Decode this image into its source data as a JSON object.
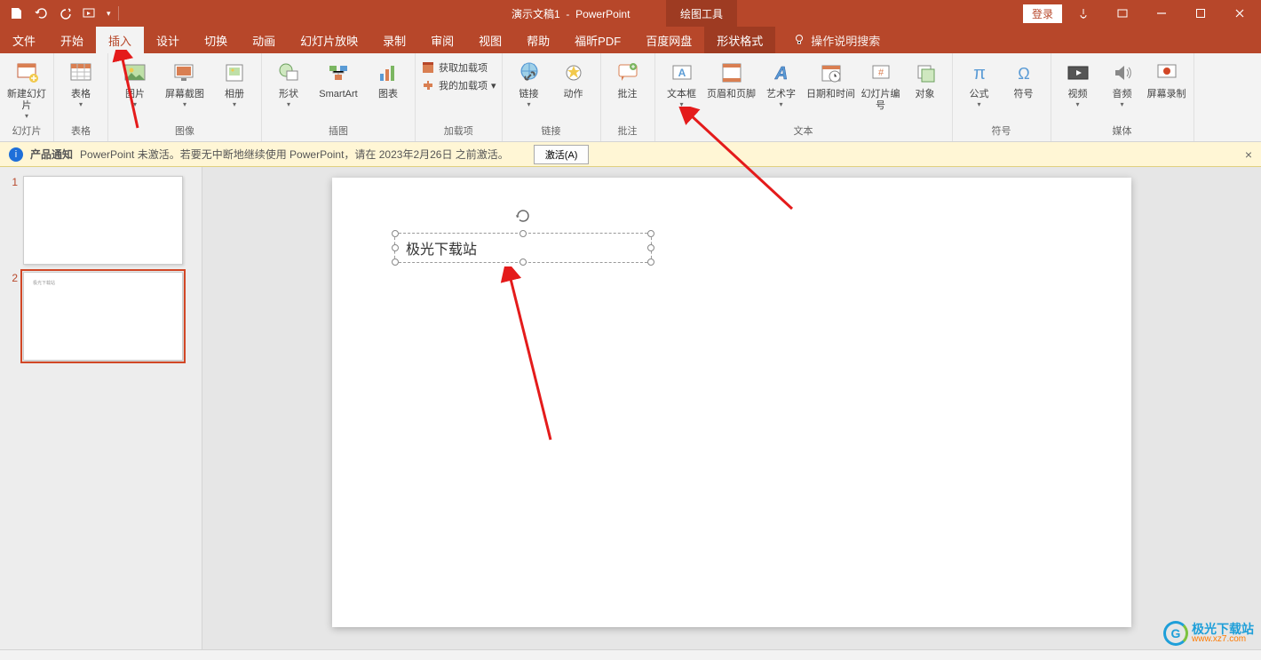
{
  "title": {
    "doc": "演示文稿1",
    "app": "PowerPoint"
  },
  "context_tab_group": "绘图工具",
  "login": "登录",
  "tabs": {
    "file": "文件",
    "home": "开始",
    "insert": "插入",
    "design": "设计",
    "transitions": "切换",
    "animations": "动画",
    "slideshow": "幻灯片放映",
    "record": "录制",
    "review": "审阅",
    "view": "视图",
    "help": "帮助",
    "foxit": "福昕PDF",
    "baidu": "百度网盘",
    "shapeformat": "形状格式"
  },
  "tell_me": "操作说明搜索",
  "ribbon": {
    "new_slide": "新建幻灯片",
    "table": "表格",
    "pictures": "图片",
    "screenshot": "屏幕截图",
    "album": "相册",
    "shapes": "形状",
    "smartart": "SmartArt",
    "chart": "图表",
    "get_addins": "获取加载项",
    "my_addins": "我的加载项",
    "link": "链接",
    "action": "动作",
    "comment": "批注",
    "textbox": "文本框",
    "header_footer": "页眉和页脚",
    "wordart": "艺术字",
    "datetime": "日期和时间",
    "slide_number": "幻灯片编号",
    "object": "对象",
    "equation": "公式",
    "symbol": "符号",
    "video": "视频",
    "audio": "音频",
    "screen_rec": "屏幕录制"
  },
  "groups": {
    "slides": "幻灯片",
    "tables": "表格",
    "images": "图像",
    "illustrations": "插图",
    "addins": "加载项",
    "links": "链接",
    "comments": "批注",
    "text": "文本",
    "symbols": "符号",
    "media": "媒体"
  },
  "msgbar": {
    "badge": "产品通知",
    "text": "PowerPoint 未激活。若要无中断地继续使用 PowerPoint，请在 2023年2月26日 之前激活。",
    "activate": "激活(A)"
  },
  "slides_panel": {
    "n1": "1",
    "n2": "2"
  },
  "textbox_content": "极光下载站",
  "thumb_tiny": "极光下载站",
  "watermark": {
    "name": "极光下载站",
    "url": "www.xz7.com",
    "g": "G"
  }
}
